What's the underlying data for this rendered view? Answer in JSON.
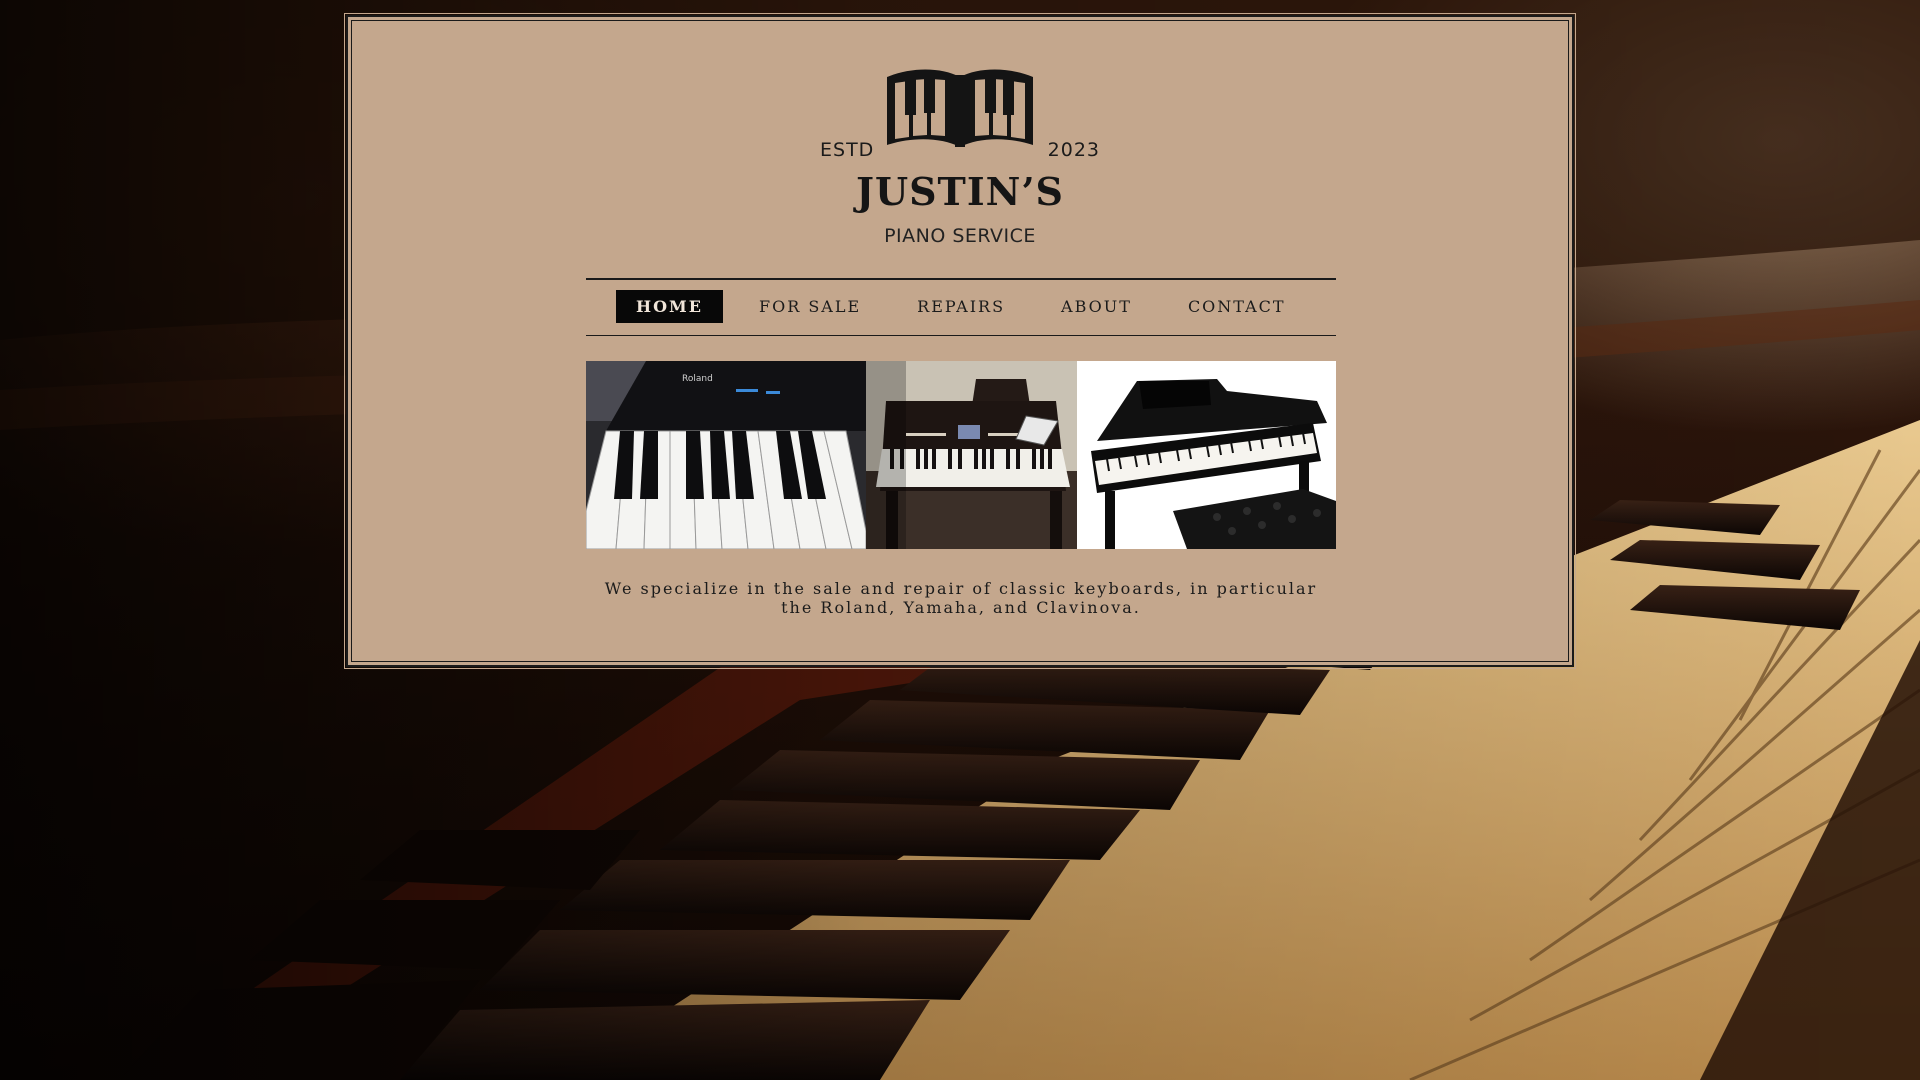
{
  "logo": {
    "estd_label": "ESTD",
    "year": "2023",
    "name": "JUSTIN’S",
    "subtitle": "PIANO SERVICE",
    "icon": "piano-book-icon"
  },
  "nav": {
    "items": [
      {
        "label": "HOME",
        "active": true
      },
      {
        "label": "FOR SALE",
        "active": false
      },
      {
        "label": "REPAIRS",
        "active": false
      },
      {
        "label": "ABOUT",
        "active": false
      },
      {
        "label": "CONTACT",
        "active": false
      }
    ]
  },
  "photos": [
    {
      "subject": "roland-digital-piano-photo",
      "brand_text": "Roland"
    },
    {
      "subject": "clavinova-digital-piano-photo"
    },
    {
      "subject": "yamaha-digital-grand-piano-photo"
    }
  ],
  "content": {
    "tagline": "We specialize in the sale and repair of classic keyboards, in particular the Roland, Yamaha, and Clavinova."
  },
  "colors": {
    "panel_background": "#c4a78d",
    "text": "#1b1b1b",
    "active_nav_background": "#080808",
    "active_nav_text": "#f1e6da"
  }
}
